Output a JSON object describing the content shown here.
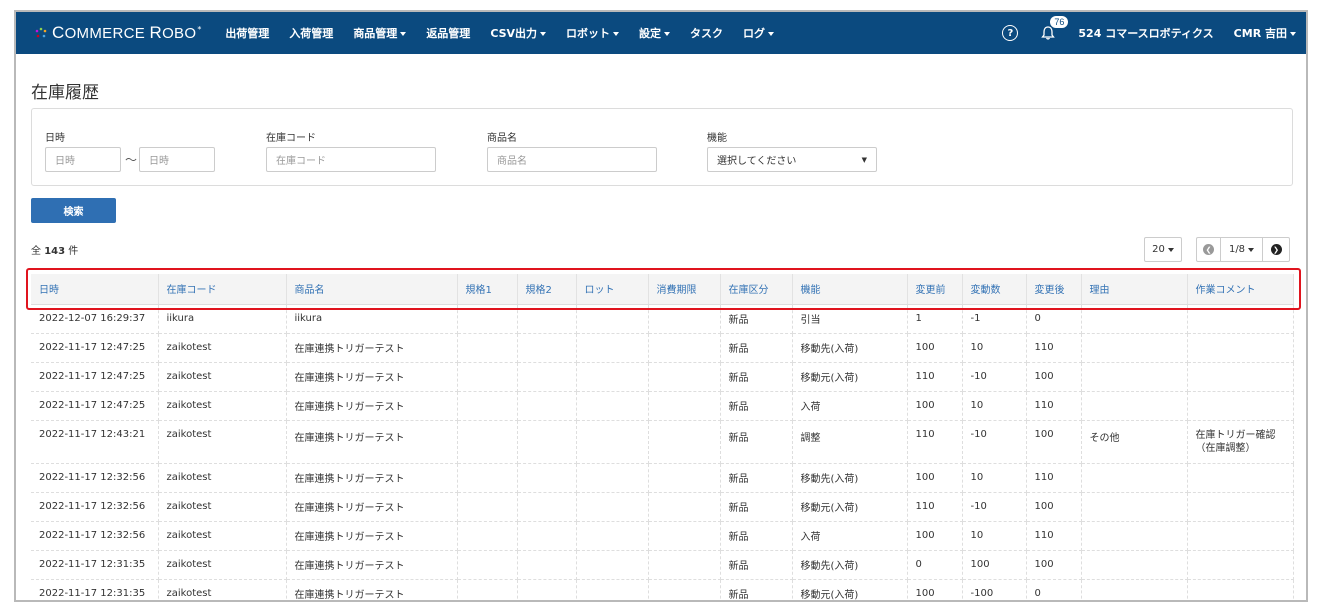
{
  "navbar": {
    "brand": "Commerce Robo",
    "brand_mark": "*",
    "items": [
      {
        "label": "出荷管理",
        "dropdown": false
      },
      {
        "label": "入荷管理",
        "dropdown": false
      },
      {
        "label": "商品管理",
        "dropdown": true
      },
      {
        "label": "返品管理",
        "dropdown": false
      },
      {
        "label": "CSV出力",
        "dropdown": true
      },
      {
        "label": "ロボット",
        "dropdown": true
      },
      {
        "label": "設定",
        "dropdown": true
      },
      {
        "label": "タスク",
        "dropdown": false
      },
      {
        "label": "ログ",
        "dropdown": true
      }
    ],
    "help_icon": "question-circle-icon",
    "bell_icon": "bell-icon",
    "notification_count": "76",
    "company": "524 コマースロボティクス",
    "user": "CMR 吉田",
    "color": "#0b4a7f"
  },
  "page": {
    "title": "在庫履歴"
  },
  "filters": {
    "datetime_label": "日時",
    "datetime_from_placeholder": "日時",
    "range_separator": "〜",
    "datetime_to_placeholder": "日時",
    "stock_code_label": "在庫コード",
    "stock_code_placeholder": "在庫コード",
    "product_name_label": "商品名",
    "product_name_placeholder": "商品名",
    "function_label": "機能",
    "function_value": "選択してください"
  },
  "search_button": "検索",
  "result": {
    "prefix": "全",
    "count": "143",
    "suffix": "件"
  },
  "pagination": {
    "per_page": "20",
    "page": "1/8"
  },
  "table": {
    "headers": [
      "日時",
      "在庫コード",
      "商品名",
      "規格1",
      "規格2",
      "ロット",
      "消費期限",
      "在庫区分",
      "機能",
      "変更前",
      "変動数",
      "変更後",
      "理由",
      "作業コメント"
    ],
    "rows": [
      [
        "2022-12-07 16:29:37",
        "iikura",
        "iikura",
        "",
        "",
        "",
        "",
        "新品",
        "引当",
        "1",
        "-1",
        "0",
        "",
        ""
      ],
      [
        "2022-11-17 12:47:25",
        "zaikotest",
        "在庫連携トリガーテスト",
        "",
        "",
        "",
        "",
        "新品",
        "移動先(入荷)",
        "100",
        "10",
        "110",
        "",
        ""
      ],
      [
        "2022-11-17 12:47:25",
        "zaikotest",
        "在庫連携トリガーテスト",
        "",
        "",
        "",
        "",
        "新品",
        "移動元(入荷)",
        "110",
        "-10",
        "100",
        "",
        ""
      ],
      [
        "2022-11-17 12:47:25",
        "zaikotest",
        "在庫連携トリガーテスト",
        "",
        "",
        "",
        "",
        "新品",
        "入荷",
        "100",
        "10",
        "110",
        "",
        ""
      ],
      [
        "2022-11-17 12:43:21",
        "zaikotest",
        "在庫連携トリガーテスト",
        "",
        "",
        "",
        "",
        "新品",
        "調整",
        "110",
        "-10",
        "100",
        "その他",
        "在庫トリガー確認（在庫調整）"
      ],
      [
        "2022-11-17 12:32:56",
        "zaikotest",
        "在庫連携トリガーテスト",
        "",
        "",
        "",
        "",
        "新品",
        "移動先(入荷)",
        "100",
        "10",
        "110",
        "",
        ""
      ],
      [
        "2022-11-17 12:32:56",
        "zaikotest",
        "在庫連携トリガーテスト",
        "",
        "",
        "",
        "",
        "新品",
        "移動元(入荷)",
        "110",
        "-10",
        "100",
        "",
        ""
      ],
      [
        "2022-11-17 12:32:56",
        "zaikotest",
        "在庫連携トリガーテスト",
        "",
        "",
        "",
        "",
        "新品",
        "入荷",
        "100",
        "10",
        "110",
        "",
        ""
      ],
      [
        "2022-11-17 12:31:35",
        "zaikotest",
        "在庫連携トリガーテスト",
        "",
        "",
        "",
        "",
        "新品",
        "移動先(入荷)",
        "0",
        "100",
        "100",
        "",
        ""
      ],
      [
        "2022-11-17 12:31:35",
        "zaikotest",
        "在庫連携トリガーテスト",
        "",
        "",
        "",
        "",
        "新品",
        "移動元(入荷)",
        "100",
        "-100",
        "0",
        "",
        ""
      ]
    ]
  },
  "highlight_color": "#e0141e"
}
